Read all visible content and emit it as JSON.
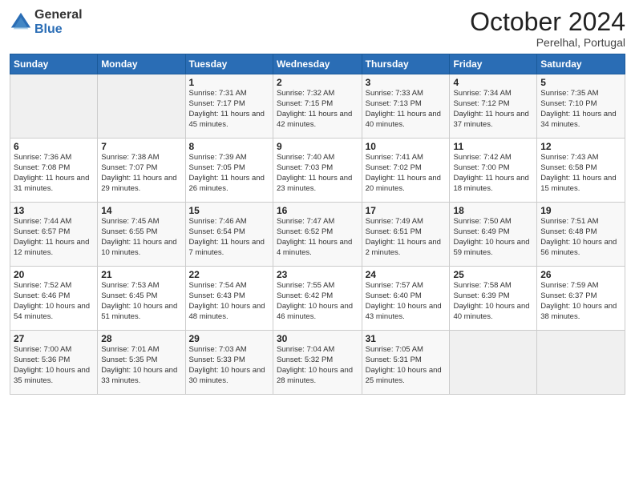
{
  "logo": {
    "general": "General",
    "blue": "Blue"
  },
  "header": {
    "title": "October 2024",
    "location": "Perelhal, Portugal"
  },
  "days": [
    "Sunday",
    "Monday",
    "Tuesday",
    "Wednesday",
    "Thursday",
    "Friday",
    "Saturday"
  ],
  "weeks": [
    [
      {
        "day": "",
        "sunrise": "",
        "sunset": "",
        "daylight": ""
      },
      {
        "day": "",
        "sunrise": "",
        "sunset": "",
        "daylight": ""
      },
      {
        "day": "1",
        "sunrise": "Sunrise: 7:31 AM",
        "sunset": "Sunset: 7:17 PM",
        "daylight": "Daylight: 11 hours and 45 minutes."
      },
      {
        "day": "2",
        "sunrise": "Sunrise: 7:32 AM",
        "sunset": "Sunset: 7:15 PM",
        "daylight": "Daylight: 11 hours and 42 minutes."
      },
      {
        "day": "3",
        "sunrise": "Sunrise: 7:33 AM",
        "sunset": "Sunset: 7:13 PM",
        "daylight": "Daylight: 11 hours and 40 minutes."
      },
      {
        "day": "4",
        "sunrise": "Sunrise: 7:34 AM",
        "sunset": "Sunset: 7:12 PM",
        "daylight": "Daylight: 11 hours and 37 minutes."
      },
      {
        "day": "5",
        "sunrise": "Sunrise: 7:35 AM",
        "sunset": "Sunset: 7:10 PM",
        "daylight": "Daylight: 11 hours and 34 minutes."
      }
    ],
    [
      {
        "day": "6",
        "sunrise": "Sunrise: 7:36 AM",
        "sunset": "Sunset: 7:08 PM",
        "daylight": "Daylight: 11 hours and 31 minutes."
      },
      {
        "day": "7",
        "sunrise": "Sunrise: 7:38 AM",
        "sunset": "Sunset: 7:07 PM",
        "daylight": "Daylight: 11 hours and 29 minutes."
      },
      {
        "day": "8",
        "sunrise": "Sunrise: 7:39 AM",
        "sunset": "Sunset: 7:05 PM",
        "daylight": "Daylight: 11 hours and 26 minutes."
      },
      {
        "day": "9",
        "sunrise": "Sunrise: 7:40 AM",
        "sunset": "Sunset: 7:03 PM",
        "daylight": "Daylight: 11 hours and 23 minutes."
      },
      {
        "day": "10",
        "sunrise": "Sunrise: 7:41 AM",
        "sunset": "Sunset: 7:02 PM",
        "daylight": "Daylight: 11 hours and 20 minutes."
      },
      {
        "day": "11",
        "sunrise": "Sunrise: 7:42 AM",
        "sunset": "Sunset: 7:00 PM",
        "daylight": "Daylight: 11 hours and 18 minutes."
      },
      {
        "day": "12",
        "sunrise": "Sunrise: 7:43 AM",
        "sunset": "Sunset: 6:58 PM",
        "daylight": "Daylight: 11 hours and 15 minutes."
      }
    ],
    [
      {
        "day": "13",
        "sunrise": "Sunrise: 7:44 AM",
        "sunset": "Sunset: 6:57 PM",
        "daylight": "Daylight: 11 hours and 12 minutes."
      },
      {
        "day": "14",
        "sunrise": "Sunrise: 7:45 AM",
        "sunset": "Sunset: 6:55 PM",
        "daylight": "Daylight: 11 hours and 10 minutes."
      },
      {
        "day": "15",
        "sunrise": "Sunrise: 7:46 AM",
        "sunset": "Sunset: 6:54 PM",
        "daylight": "Daylight: 11 hours and 7 minutes."
      },
      {
        "day": "16",
        "sunrise": "Sunrise: 7:47 AM",
        "sunset": "Sunset: 6:52 PM",
        "daylight": "Daylight: 11 hours and 4 minutes."
      },
      {
        "day": "17",
        "sunrise": "Sunrise: 7:49 AM",
        "sunset": "Sunset: 6:51 PM",
        "daylight": "Daylight: 11 hours and 2 minutes."
      },
      {
        "day": "18",
        "sunrise": "Sunrise: 7:50 AM",
        "sunset": "Sunset: 6:49 PM",
        "daylight": "Daylight: 10 hours and 59 minutes."
      },
      {
        "day": "19",
        "sunrise": "Sunrise: 7:51 AM",
        "sunset": "Sunset: 6:48 PM",
        "daylight": "Daylight: 10 hours and 56 minutes."
      }
    ],
    [
      {
        "day": "20",
        "sunrise": "Sunrise: 7:52 AM",
        "sunset": "Sunset: 6:46 PM",
        "daylight": "Daylight: 10 hours and 54 minutes."
      },
      {
        "day": "21",
        "sunrise": "Sunrise: 7:53 AM",
        "sunset": "Sunset: 6:45 PM",
        "daylight": "Daylight: 10 hours and 51 minutes."
      },
      {
        "day": "22",
        "sunrise": "Sunrise: 7:54 AM",
        "sunset": "Sunset: 6:43 PM",
        "daylight": "Daylight: 10 hours and 48 minutes."
      },
      {
        "day": "23",
        "sunrise": "Sunrise: 7:55 AM",
        "sunset": "Sunset: 6:42 PM",
        "daylight": "Daylight: 10 hours and 46 minutes."
      },
      {
        "day": "24",
        "sunrise": "Sunrise: 7:57 AM",
        "sunset": "Sunset: 6:40 PM",
        "daylight": "Daylight: 10 hours and 43 minutes."
      },
      {
        "day": "25",
        "sunrise": "Sunrise: 7:58 AM",
        "sunset": "Sunset: 6:39 PM",
        "daylight": "Daylight: 10 hours and 40 minutes."
      },
      {
        "day": "26",
        "sunrise": "Sunrise: 7:59 AM",
        "sunset": "Sunset: 6:37 PM",
        "daylight": "Daylight: 10 hours and 38 minutes."
      }
    ],
    [
      {
        "day": "27",
        "sunrise": "Sunrise: 7:00 AM",
        "sunset": "Sunset: 5:36 PM",
        "daylight": "Daylight: 10 hours and 35 minutes."
      },
      {
        "day": "28",
        "sunrise": "Sunrise: 7:01 AM",
        "sunset": "Sunset: 5:35 PM",
        "daylight": "Daylight: 10 hours and 33 minutes."
      },
      {
        "day": "29",
        "sunrise": "Sunrise: 7:03 AM",
        "sunset": "Sunset: 5:33 PM",
        "daylight": "Daylight: 10 hours and 30 minutes."
      },
      {
        "day": "30",
        "sunrise": "Sunrise: 7:04 AM",
        "sunset": "Sunset: 5:32 PM",
        "daylight": "Daylight: 10 hours and 28 minutes."
      },
      {
        "day": "31",
        "sunrise": "Sunrise: 7:05 AM",
        "sunset": "Sunset: 5:31 PM",
        "daylight": "Daylight: 10 hours and 25 minutes."
      },
      {
        "day": "",
        "sunrise": "",
        "sunset": "",
        "daylight": ""
      },
      {
        "day": "",
        "sunrise": "",
        "sunset": "",
        "daylight": ""
      }
    ]
  ]
}
